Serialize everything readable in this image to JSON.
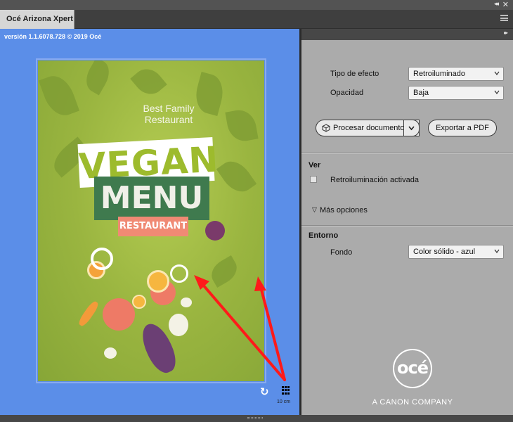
{
  "window": {
    "tab_title": "Océ Arizona Xpert",
    "collapse_glyph": "◂◂",
    "close_glyph": "✕"
  },
  "preview": {
    "version_text": "versión 1.1.6078.728 © 2019 Océ",
    "poster": {
      "tagline": "Best Family Restaurant",
      "title_line1": "VEGAN",
      "title_line2": "MENU",
      "badge": "RESTAURANT"
    },
    "reset_glyph": "↻",
    "scale_label": "10 cm",
    "background_color": "#5b8ee8"
  },
  "panel": {
    "expand_glyph": "▸▸",
    "effect_type": {
      "label": "Tipo de efecto",
      "value": "Retroiluminado"
    },
    "opacity": {
      "label": "Opacidad",
      "value": "Baja"
    },
    "process_button": "Procesar documento",
    "export_button": "Exportar a PDF",
    "view": {
      "title": "Ver",
      "backlight_checkbox": "Retroiluminación activada",
      "more_options": "Más opciones",
      "more_glyph": "▽"
    },
    "environment": {
      "title": "Entorno",
      "background": {
        "label": "Fondo",
        "value": "Color sólido - azul"
      }
    },
    "logo_text": "océ",
    "company_text": "A CANON COMPANY"
  },
  "colors": {
    "accent_red": "#ff1a1a",
    "panel_gray": "#ababab"
  }
}
